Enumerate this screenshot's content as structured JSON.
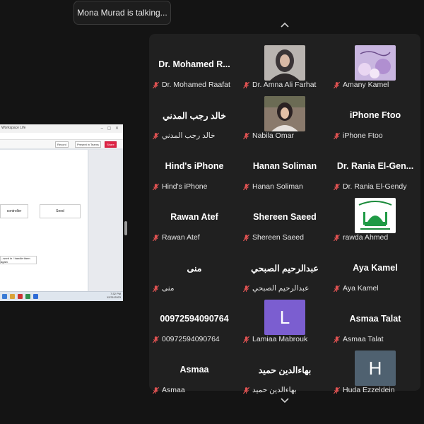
{
  "speaking_notice": "Mona Murad is talking...",
  "shared_screen": {
    "tab_text": "Workspace Life",
    "url_text": "",
    "buttons": [
      "Record",
      "Present in Teams",
      "Share"
    ],
    "boxes": [
      "controller",
      "Seed"
    ],
    "note": "...word in / handle them again",
    "time": "7:32 PM",
    "date": "12/31/2023"
  },
  "gallery": {
    "participants": [
      {
        "display_name": "Dr. Mohamed R...",
        "label": "Dr. Mohamed Raafat",
        "avatar": "none"
      },
      {
        "display_name": "",
        "label": "Dr. Amna Ali Farhat",
        "avatar": "photo-woman-hijab"
      },
      {
        "display_name": "",
        "label": "Amany Kamel",
        "avatar": "photo-flowers"
      },
      {
        "display_name": "خالد رجب المدني",
        "label": "خالد رجب المدني",
        "avatar": "none"
      },
      {
        "display_name": "",
        "label": "Nabila Omar",
        "avatar": "photo-woman"
      },
      {
        "display_name": "iPhone Ftoo",
        "label": "iPhone Ftoo",
        "avatar": "none"
      },
      {
        "display_name": "Hind's iPhone",
        "label": "Hind's iPhone",
        "avatar": "none"
      },
      {
        "display_name": "Hanan Soliman",
        "label": "Hanan Soliman",
        "avatar": "none"
      },
      {
        "display_name": "Dr. Rania El-Gen...",
        "label": "Dr. Rania El-Gendy",
        "avatar": "none"
      },
      {
        "display_name": "Rawan Atef",
        "label": "Rawan Atef",
        "avatar": "none"
      },
      {
        "display_name": "Shereen Saeed",
        "label": "Shereen Saeed",
        "avatar": "none"
      },
      {
        "display_name": "",
        "label": "rawda Ahmed",
        "avatar": "photo-mosque"
      },
      {
        "display_name": "منى",
        "label": "منى",
        "avatar": "none"
      },
      {
        "display_name": "عبدالرحيم الصبحي",
        "label": "عبدالرحيم الصبحي",
        "avatar": "none"
      },
      {
        "display_name": "Aya Kamel",
        "label": "Aya Kamel",
        "avatar": "none"
      },
      {
        "display_name": "00972594090764",
        "label": "00972594090764",
        "avatar": "none"
      },
      {
        "display_name": "",
        "label": "Lamiaa Mabrouk",
        "avatar": "letter",
        "avatar_letter": "L",
        "avatar_color": "#7b5ed0"
      },
      {
        "display_name": "Asmaa Talat",
        "label": "Asmaa Talat",
        "avatar": "none"
      },
      {
        "display_name": "Asmaa",
        "label": "Asmaa",
        "avatar": "none"
      },
      {
        "display_name": "بهاءالدين حميد",
        "label": "بهاءالدين حميد",
        "avatar": "none"
      },
      {
        "display_name": "",
        "label": "Huda Ezzeldein",
        "avatar": "letter",
        "avatar_letter": "H",
        "avatar_color": "#4f6170"
      }
    ]
  },
  "icons": {
    "muted": "mic-muted-icon",
    "up": "chevron-up-icon",
    "down": "chevron-down-icon"
  },
  "colors": {
    "muted_red": "#e05252",
    "gallery_bg": "#202020"
  }
}
